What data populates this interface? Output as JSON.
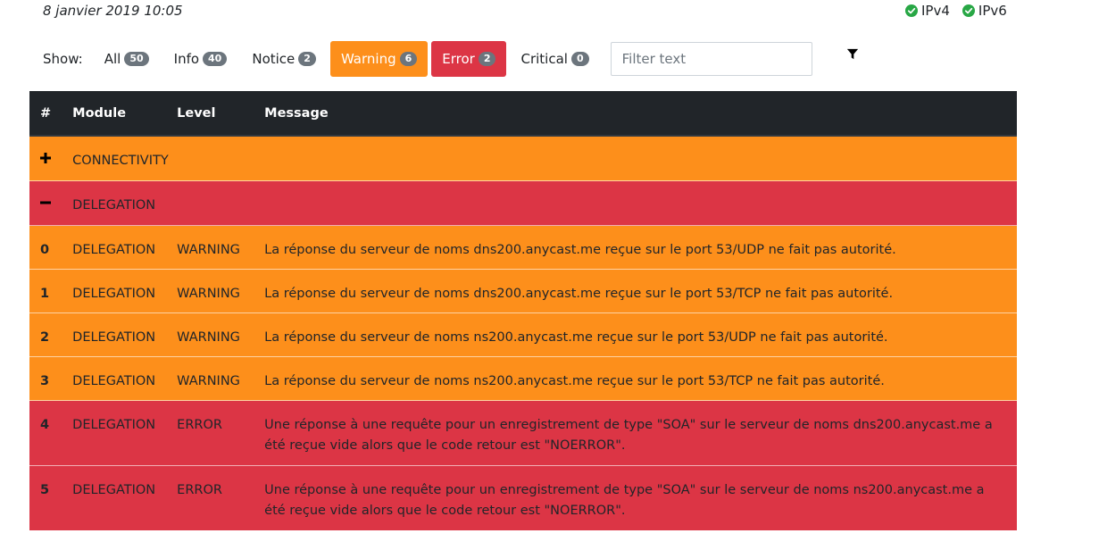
{
  "header": {
    "date": "8 janvier 2019 10:05",
    "ip": [
      {
        "label": "IPv4",
        "status_color": "#28a745"
      },
      {
        "label": "IPv6",
        "status_color": "#28a745"
      }
    ]
  },
  "filters": {
    "show_label": "Show:",
    "buttons": [
      {
        "label": "All",
        "count": "50",
        "style": "plain"
      },
      {
        "label": "Info",
        "count": "40",
        "style": "plain"
      },
      {
        "label": "Notice",
        "count": "2",
        "style": "plain"
      },
      {
        "label": "Warning",
        "count": "6",
        "style": "warning"
      },
      {
        "label": "Error",
        "count": "2",
        "style": "error"
      },
      {
        "label": "Critical",
        "count": "0",
        "style": "plain"
      }
    ],
    "search_placeholder": "Filter text",
    "filter_icon": "funnel-icon"
  },
  "table": {
    "headers": [
      "#",
      "Module",
      "Level",
      "Message"
    ],
    "groups": [
      {
        "toggle": "+",
        "module": "CONNECTIVITY",
        "style": "warning"
      },
      {
        "toggle": "−",
        "module": "DELEGATION",
        "style": "error"
      }
    ],
    "rows": [
      {
        "num": "0",
        "module": "DELEGATION",
        "level": "WARNING",
        "message": "La réponse du serveur de noms dns200.anycast.me reçue sur le port 53/UDP ne fait pas autorité."
      },
      {
        "num": "1",
        "module": "DELEGATION",
        "level": "WARNING",
        "message": "La réponse du serveur de noms dns200.anycast.me reçue sur le port 53/TCP ne fait pas autorité."
      },
      {
        "num": "2",
        "module": "DELEGATION",
        "level": "WARNING",
        "message": "La réponse du serveur de noms ns200.anycast.me reçue sur le port 53/UDP ne fait pas autorité."
      },
      {
        "num": "3",
        "module": "DELEGATION",
        "level": "WARNING",
        "message": "La réponse du serveur de noms ns200.anycast.me reçue sur le port 53/TCP ne fait pas autorité."
      },
      {
        "num": "4",
        "module": "DELEGATION",
        "level": "ERROR",
        "message": "Une réponse à une requête pour un enregistrement de type \"SOA\" sur le serveur de noms dns200.anycast.me a été reçue vide alors que le code retour est \"NOERROR\"."
      },
      {
        "num": "5",
        "module": "DELEGATION",
        "level": "ERROR",
        "message": "Une réponse à une requête pour un enregistrement de type \"SOA\" sur le serveur de noms ns200.anycast.me a été reçue vide alors que le code retour est \"NOERROR\"."
      }
    ]
  },
  "colors": {
    "warning": "#fd8f1b",
    "error": "#dc3545",
    "header_bg": "#212529",
    "ok": "#28a745"
  }
}
